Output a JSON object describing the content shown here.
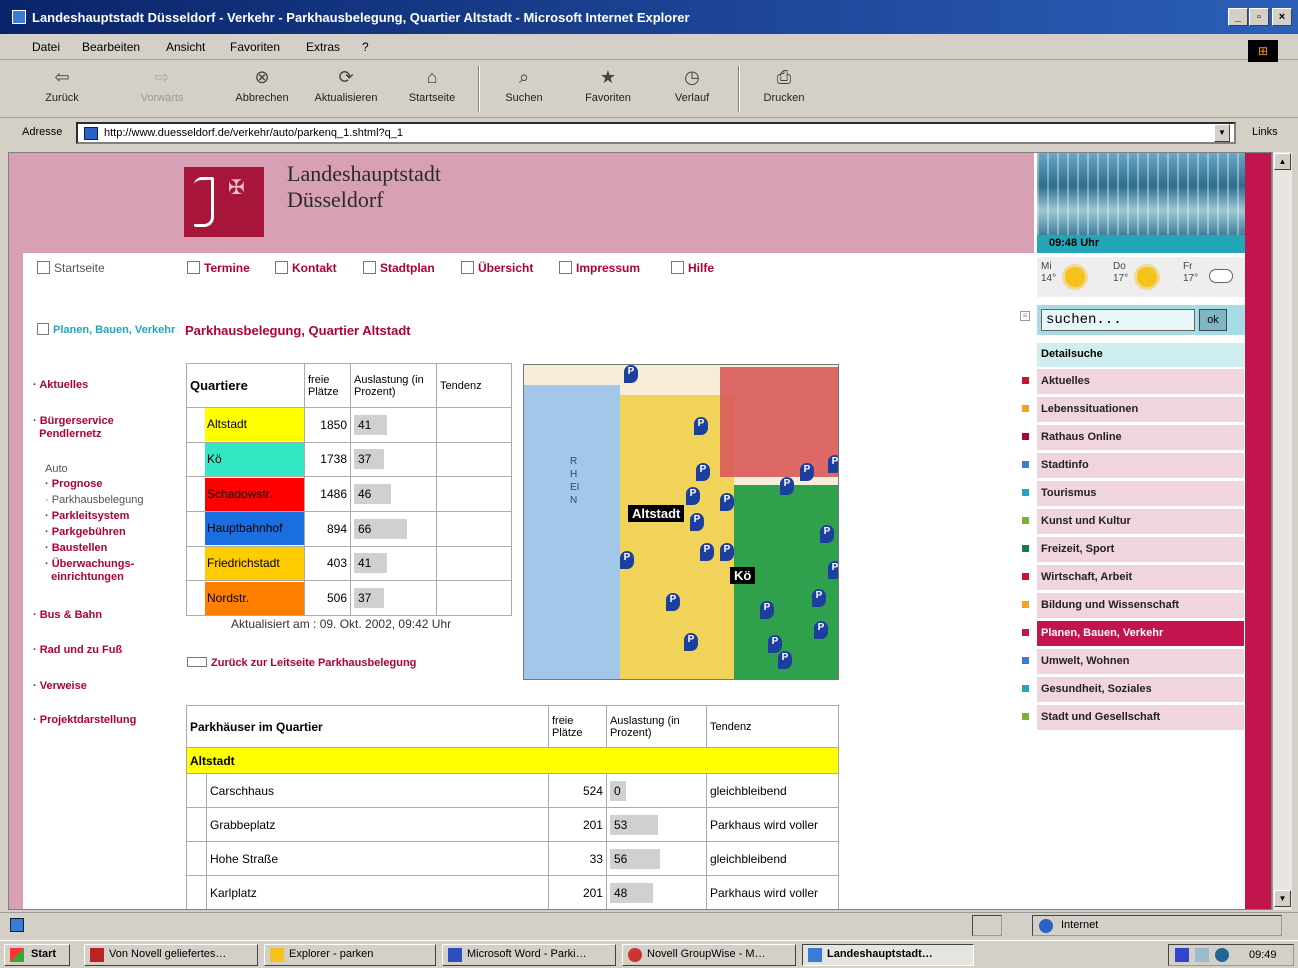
{
  "window": {
    "title": "Landeshauptstadt Düsseldorf - Verkehr - Parkhausbelegung, Quartier Altstadt - Microsoft Internet Explorer"
  },
  "menu": [
    "Datei",
    "Bearbeiten",
    "Ansicht",
    "Favoriten",
    "Extras",
    "?"
  ],
  "toolbar": {
    "back": "Zurück",
    "forward": "Vorwärts",
    "stop": "Abbrechen",
    "refresh": "Aktualisieren",
    "home": "Startseite",
    "search": "Suchen",
    "favorites": "Favoriten",
    "history": "Verlauf",
    "print": "Drucken"
  },
  "address": {
    "label": "Adresse",
    "url": "http://www.duesseldorf.de/verkehr/auto/parkenq_1.shtml?q_1",
    "links": "Links"
  },
  "site": {
    "city_line1": "Landeshauptstadt",
    "city_line2": "Düsseldorf",
    "clock": "09:48 Uhr"
  },
  "weather": [
    {
      "day": "Mi",
      "temp": "14°",
      "icon": "sun-icon"
    },
    {
      "day": "Do",
      "temp": "17°",
      "icon": "sun-icon"
    },
    {
      "day": "Fr",
      "temp": "17°",
      "icon": "cloud-icon"
    }
  ],
  "topnav": {
    "home": "Startseite",
    "items": [
      "Termine",
      "Kontakt",
      "Stadtplan",
      "Übersicht",
      "Impressum",
      "Hilfe"
    ]
  },
  "leftnav": {
    "section": "Planen, Bauen, Verkehr",
    "aktuelles": "Aktuelles",
    "buergerservice": "Bürgerservice",
    "pendlernetz": "Pendlernetz",
    "auto": "Auto",
    "sub": [
      "Prognose",
      "Parkhausbelegung",
      "Parkleitsystem",
      "Parkgebühren",
      "Baustellen",
      "Überwachungs-",
      "einrichtungen"
    ],
    "bus": "Bus & Bahn",
    "rad": "Rad und zu Fuß",
    "verweise": "Verweise",
    "projekt": "Projektdarstellung"
  },
  "search": {
    "placeholder": "suchen...",
    "ok": "ok",
    "detail": "Detailsuche"
  },
  "rightnav": [
    {
      "label": "Aktuelles",
      "color": "#cc1133"
    },
    {
      "label": "Lebenssituationen",
      "color": "#f4a21a"
    },
    {
      "label": "Rathaus Online",
      "color": "#b0003a"
    },
    {
      "label": "Stadtinfo",
      "color": "#3a7bd5"
    },
    {
      "label": "Tourismus",
      "color": "#23a6b8"
    },
    {
      "label": "Kunst und Kultur",
      "color": "#7fb22a"
    },
    {
      "label": "Freizeit, Sport",
      "color": "#1a7a4a"
    },
    {
      "label": "Wirtschaft, Arbeit",
      "color": "#cc1133"
    },
    {
      "label": "Bildung und Wissenschaft",
      "color": "#f4a21a"
    },
    {
      "label": "Planen, Bauen, Verkehr",
      "color": "#c2154d"
    },
    {
      "label": "Umwelt, Wohnen",
      "color": "#3a7bd5"
    },
    {
      "label": "Gesundheit, Soziales",
      "color": "#23a6b8"
    },
    {
      "label": "Stadt und Gesellschaft",
      "color": "#7fb22a"
    }
  ],
  "page": {
    "title": "Parkhausbelegung, Quartier Altstadt",
    "updated": "Aktualisiert am : 09. Okt. 2002, 09:42 Uhr",
    "backlink": "Zurück zur Leitseite Parkhausbelegung"
  },
  "quartiere": {
    "headers": [
      "Quartiere",
      "freie Plätze",
      "Auslastung (in Prozent)",
      "Tendenz"
    ],
    "rows": [
      {
        "name": "Altstadt",
        "free": "1850",
        "load": 41,
        "color": "#ffff00"
      },
      {
        "name": "Kö",
        "free": "1738",
        "load": 37,
        "color": "#33e6c4"
      },
      {
        "name": "Schadowstr.",
        "free": "1486",
        "load": 46,
        "color": "#ff0000"
      },
      {
        "name": "Hauptbahnhof",
        "free": "894",
        "load": 66,
        "color": "#1a6ee0"
      },
      {
        "name": "Friedrichstadt",
        "free": "403",
        "load": 41,
        "color": "#ffcc00"
      },
      {
        "name": "Nordstr.",
        "free": "506",
        "load": 37,
        "color": "#ff7f00"
      }
    ]
  },
  "map": {
    "altstadt": "Altstadt",
    "ko": "Kö",
    "river": "RHEIN",
    "parking": "P"
  },
  "parkhaeuser": {
    "headers": [
      "Parkhäuser im Quartier",
      "freie Plätze",
      "Auslastung (in Prozent)",
      "Tendenz"
    ],
    "group": "Altstadt",
    "rows": [
      {
        "name": "Carschhaus",
        "free": "524",
        "load": 0,
        "trend": "gleichbleibend"
      },
      {
        "name": "Grabbeplatz",
        "free": "201",
        "load": 53,
        "trend": "Parkhaus wird voller"
      },
      {
        "name": "Hohe Straße",
        "free": "33",
        "load": 56,
        "trend": "gleichbleibend"
      },
      {
        "name": "Karlplatz",
        "free": "201",
        "load": 48,
        "trend": "Parkhaus wird voller"
      }
    ]
  },
  "status": {
    "zone": "Internet"
  },
  "taskbar": {
    "start": "Start",
    "items": [
      "Von Novell geliefertes…",
      "Explorer - parken",
      "Microsoft Word - Parki…",
      "Novell GroupWise - M…",
      "Landeshauptstadt…"
    ],
    "time": "09:49"
  }
}
